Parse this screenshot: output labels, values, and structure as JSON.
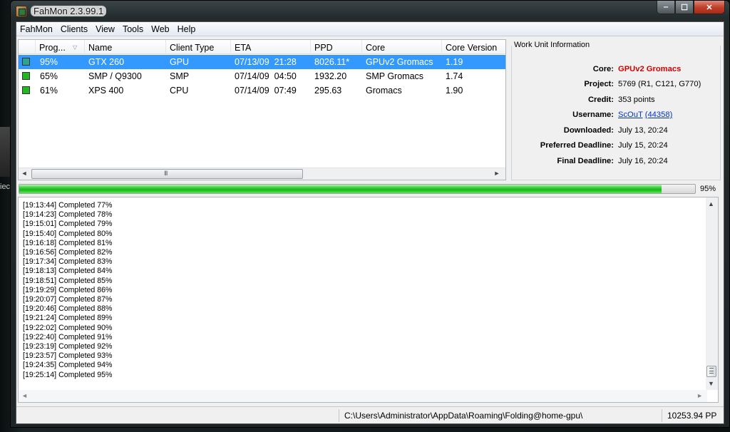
{
  "window": {
    "title": "FahMon 2.3.99.1",
    "minimize": "‒",
    "maximize": "☐",
    "close": "✕"
  },
  "desktop": {
    "edge_text": "iec"
  },
  "menu": [
    "FahMon",
    "Clients",
    "View",
    "Tools",
    "Web",
    "Help"
  ],
  "clients": {
    "columns": [
      "Prog...",
      "Name",
      "Client Type",
      "ETA",
      "PPD",
      "Core",
      "Core Version"
    ],
    "rows": [
      {
        "progress": "95%",
        "name": "GTX 260",
        "type": "GPU",
        "eta": "07/13/09  21:28",
        "ppd": "8026.11*",
        "core": "GPUv2 Gromacs",
        "version": "1.19",
        "status_color": "#2ea38f"
      },
      {
        "progress": "65%",
        "name": "SMP / Q9300",
        "type": "SMP",
        "eta": "07/14/09  04:50",
        "ppd": "1932.20",
        "core": "SMP Gromacs",
        "version": "1.74",
        "status_color": "#22b822"
      },
      {
        "progress": "61%",
        "name": "XPS 400",
        "type": "CPU",
        "eta": "07/14/09  07:49",
        "ppd": "295.63",
        "core": "Gromacs",
        "version": "1.90",
        "status_color": "#22b822"
      }
    ],
    "scroll_grip": "III",
    "arrow_left": "◄",
    "arrow_right": "►"
  },
  "work_unit": {
    "title": "Work Unit Information",
    "core_label": "Core:",
    "core": "GPUv2 Gromacs",
    "project_label": "Project:",
    "project": "5769 (R1, C121, G770)",
    "credit_label": "Credit:",
    "credit": "353 points",
    "username_label": "Username:",
    "username": "ScOuT",
    "user_id": "(44358)",
    "downloaded_label": "Downloaded:",
    "downloaded": "July 13, 20:24",
    "preferred_label": "Preferred Deadline:",
    "preferred": "July 15, 20:24",
    "final_label": "Final Deadline:",
    "final": "July 16, 20:24"
  },
  "progress": {
    "percent": 95,
    "label": "95%"
  },
  "log": [
    "[19:13:44] Completed 77%",
    "[19:14:23] Completed 78%",
    "[19:15:01] Completed 79%",
    "[19:15:40] Completed 80%",
    "[19:16:18] Completed 81%",
    "[19:16:56] Completed 82%",
    "[19:17:34] Completed 83%",
    "[19:18:13] Completed 84%",
    "[19:18:51] Completed 85%",
    "[19:19:29] Completed 86%",
    "[19:20:07] Completed 87%",
    "[19:20:46] Completed 88%",
    "[19:21:24] Completed 89%",
    "[19:22:02] Completed 90%",
    "[19:22:40] Completed 91%",
    "[19:23:19] Completed 92%",
    "[19:23:57] Completed 93%",
    "[19:24:35] Completed 94%",
    "[19:25:14] Completed 95%"
  ],
  "statusbar": {
    "path": "C:\\Users\\Administrator\\AppData\\Roaming\\Folding@home-gpu\\",
    "total_ppd": "10253.94 PP"
  }
}
